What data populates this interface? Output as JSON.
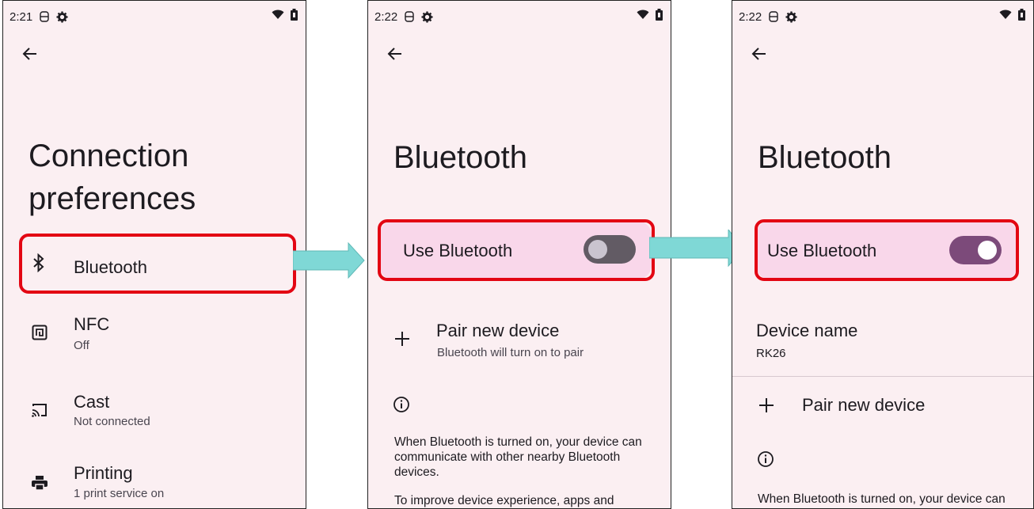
{
  "screens": [
    {
      "status": {
        "time": "2:21"
      },
      "title_line1": "Connection",
      "title_line2": "preferences",
      "items": [
        {
          "title": "Bluetooth",
          "subtitle": "",
          "icon": "bluetooth-icon"
        },
        {
          "title": "NFC",
          "subtitle": "Off",
          "icon": "nfc-icon"
        },
        {
          "title": "Cast",
          "subtitle": "Not connected",
          "icon": "cast-icon"
        },
        {
          "title": "Printing",
          "subtitle": "1 print service on",
          "icon": "print-icon"
        }
      ]
    },
    {
      "status": {
        "time": "2:22"
      },
      "title": "Bluetooth",
      "toggle_label": "Use Bluetooth",
      "toggle_state": "off",
      "pair_title": "Pair new device",
      "pair_subtitle": "Bluetooth will turn on to pair",
      "info_text": "When Bluetooth is turned on, your device can communicate with other nearby Bluetooth devices.",
      "info_text2": "To improve device experience, apps and"
    },
    {
      "status": {
        "time": "2:22"
      },
      "title": "Bluetooth",
      "toggle_label": "Use Bluetooth",
      "toggle_state": "on",
      "device_name_label": "Device name",
      "device_name_value": "RK26",
      "pair_title": "Pair new device",
      "info_text": "When Bluetooth is turned on, your device can"
    }
  ],
  "colors": {
    "highlight": "#e30613",
    "arrow": "#7fd8d6",
    "toggle_on": "#7c4a7a",
    "toggle_off": "#625b64"
  }
}
